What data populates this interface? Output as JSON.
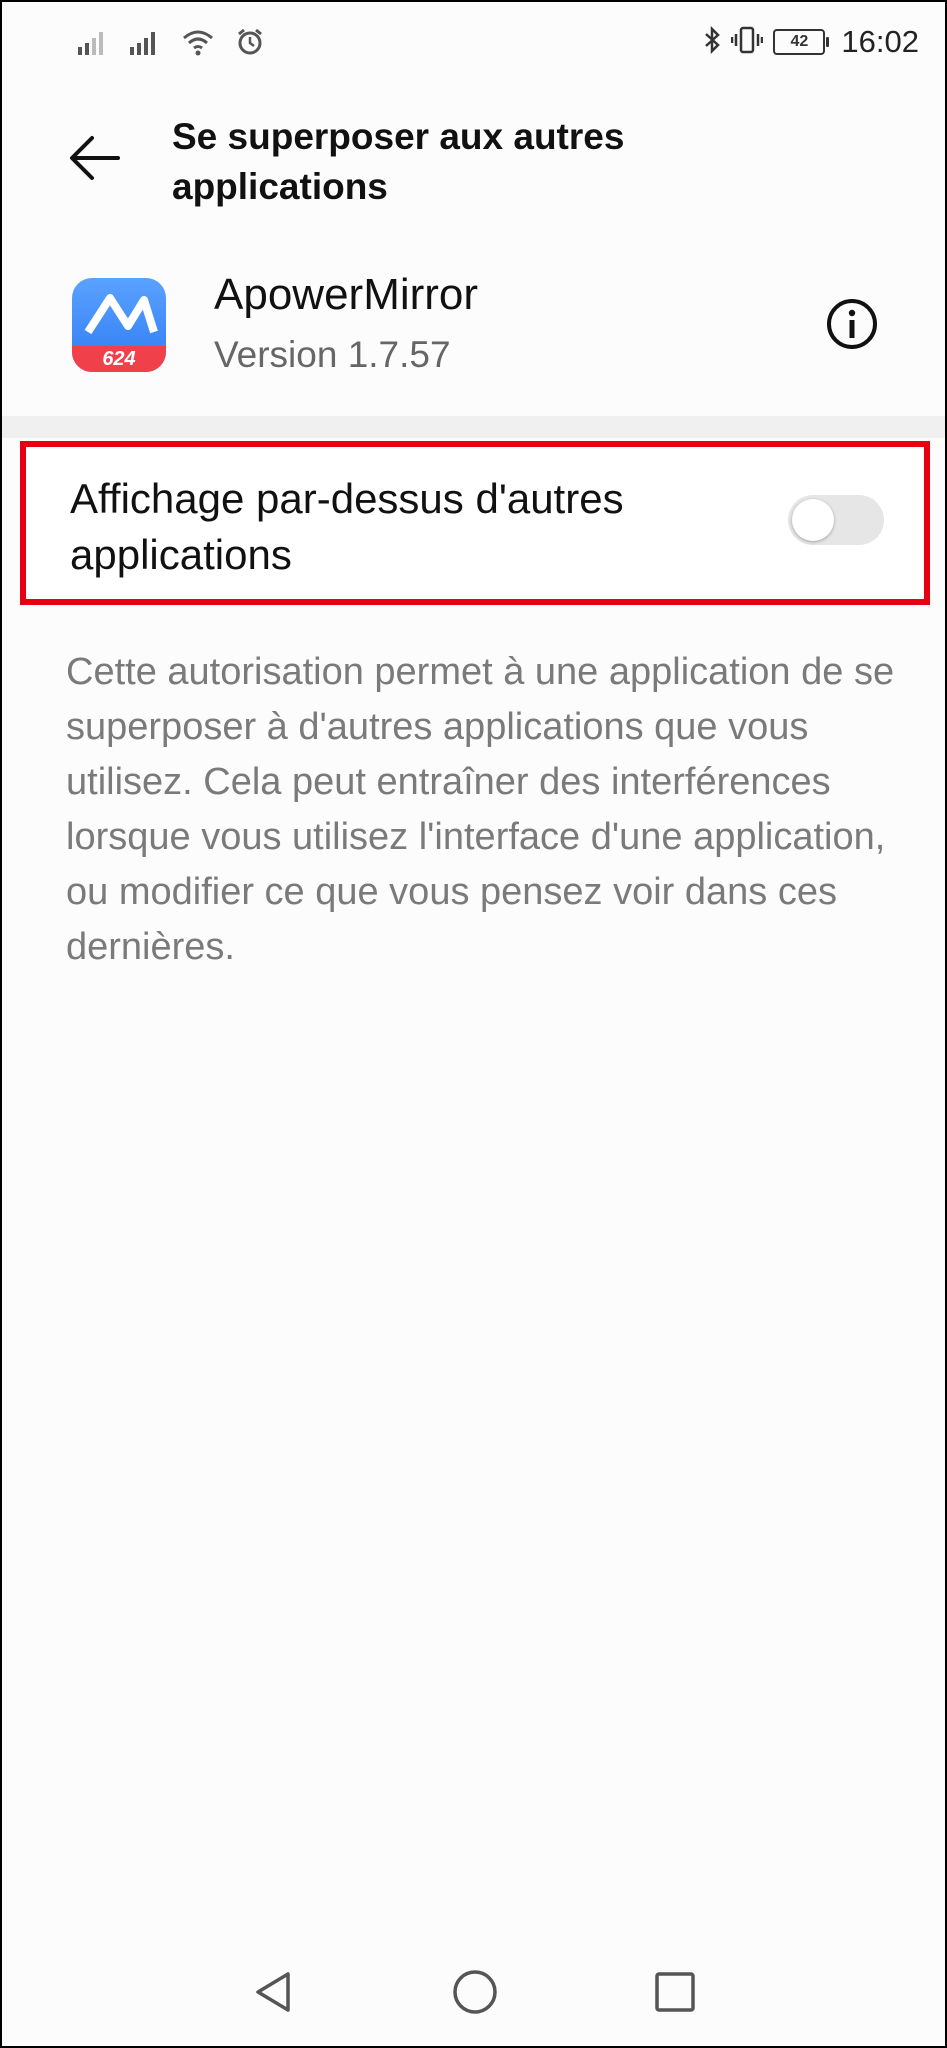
{
  "status_bar": {
    "time": "16:02",
    "battery": "42",
    "icons": [
      "signal-icon",
      "signal-icon",
      "wifi-icon",
      "alarm-icon",
      "bluetooth-icon",
      "vibrate-icon",
      "battery-icon"
    ]
  },
  "header": {
    "title": "Se superposer aux autres applications",
    "back_icon": "arrow-left-icon"
  },
  "app": {
    "name": "ApowerMirror",
    "version": "Version 1.7.57",
    "icon_badge": "624",
    "info_icon": "info-icon"
  },
  "setting": {
    "label": "Affichage par-dessus d'autres applications",
    "enabled": false
  },
  "description": "Cette autorisation permet à une application de se superposer à d'autres applications que vous utilisez. Cela peut entraîner des interférences lorsque vous utilisez l'interface d'une application, ou modifier ce que vous pensez voir dans ces dernières.",
  "highlight_color": "#e60012",
  "nav_bar": {
    "icons": [
      "back-triangle-icon",
      "home-circle-icon",
      "recents-square-icon"
    ]
  }
}
